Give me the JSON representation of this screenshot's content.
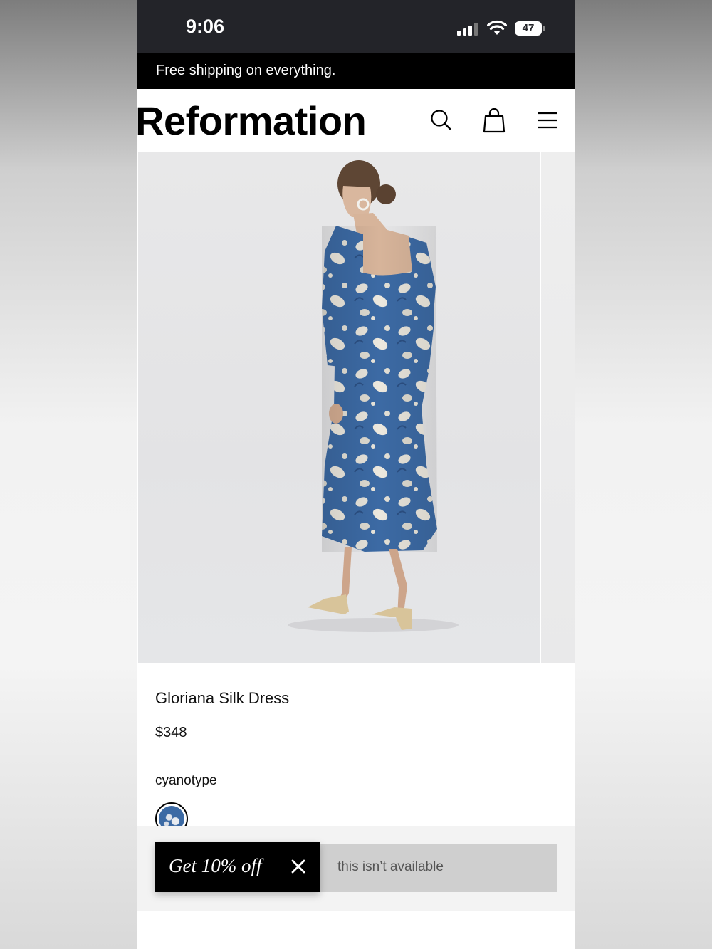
{
  "status_bar": {
    "time": "9:06",
    "battery": "47"
  },
  "banner": {
    "text": "Free shipping on everything."
  },
  "header": {
    "logo": "Reformation",
    "icons": [
      "search-icon",
      "bag-icon",
      "menu-icon"
    ]
  },
  "product": {
    "name": "Gloriana Silk Dress",
    "price": "$348",
    "color_name": "cyanotype"
  },
  "bottom": {
    "unavailable_text": "this isn’t available",
    "promo_text": "Get 10% off"
  },
  "colors": {
    "dress": "#3c6aa4",
    "banner": "#000000",
    "status_bar": "#232429"
  }
}
